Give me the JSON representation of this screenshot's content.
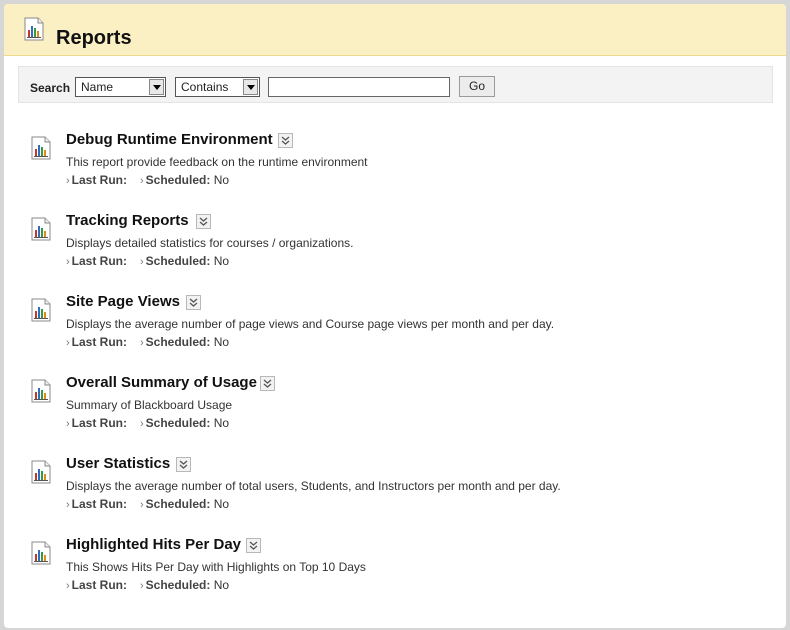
{
  "header": {
    "title": "Reports",
    "icon": "report-chart-icon"
  },
  "search": {
    "label": "Search",
    "field_select": "Name",
    "operator_select": "Contains",
    "query_value": "",
    "go_label": "Go"
  },
  "labels": {
    "last_run": "Last Run:",
    "scheduled": "Scheduled:"
  },
  "reports": [
    {
      "title": "Debug Runtime Environment",
      "description": "This report provide feedback on the runtime environment",
      "last_run": "",
      "scheduled": "No"
    },
    {
      "title": "Tracking Reports",
      "description": "Displays detailed statistics for courses / organizations.",
      "last_run": "",
      "scheduled": "No"
    },
    {
      "title": "Site Page Views",
      "description": "Displays the average number of page views and Course page views per month and per day.",
      "last_run": "",
      "scheduled": "No"
    },
    {
      "title": "Overall Summary of Usage",
      "description": "Summary of Blackboard Usage",
      "last_run": "",
      "scheduled": "No"
    },
    {
      "title": "User Statistics",
      "description": "Displays the average number of total users, Students, and Instructors per month and per day.",
      "last_run": "",
      "scheduled": "No"
    },
    {
      "title": "Highlighted Hits Per Day",
      "description": "This Shows Hits Per Day with Highlights on Top 10 Days",
      "last_run": "",
      "scheduled": "No"
    }
  ],
  "colors": {
    "header_bg": "#fbefc4",
    "header_border": "#efd98a",
    "search_bg": "#f3f3f3"
  }
}
